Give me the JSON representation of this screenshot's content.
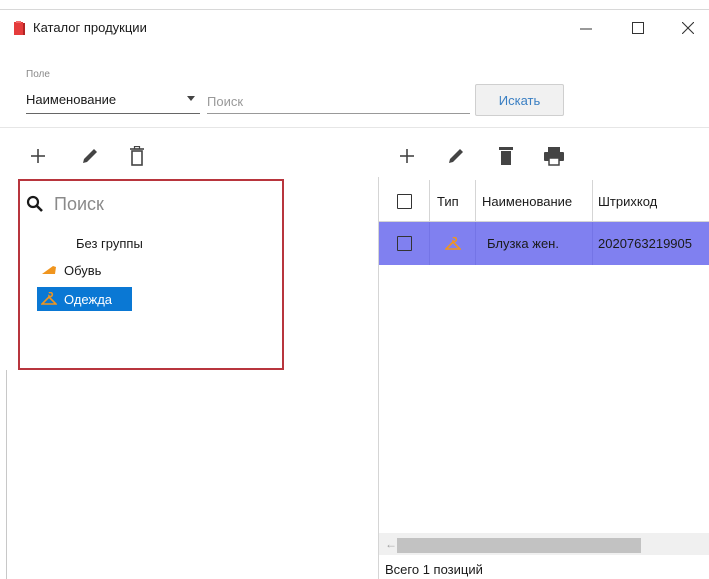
{
  "window": {
    "title": "Каталог продукции",
    "controls": {
      "minimize": "minimize",
      "maximize": "maximize",
      "close": "close"
    }
  },
  "search_form": {
    "field_label": "Поле",
    "field_value": "Наименование",
    "search_placeholder": "Поиск",
    "search_button": "Искать"
  },
  "left_toolbar": {
    "icons": [
      "plus-icon",
      "pencil-icon",
      "trash-outline-icon"
    ]
  },
  "right_toolbar": {
    "icons": [
      "plus-icon",
      "pencil-icon",
      "trash-filled-icon",
      "printer-icon"
    ]
  },
  "groups_tree": {
    "search_placeholder": "Поиск",
    "items": [
      {
        "label": "Без группы",
        "icon": "",
        "selected": false
      },
      {
        "label": "Обувь",
        "icon": "shoe-icon",
        "selected": false
      },
      {
        "label": "Одежда",
        "icon": "hanger-icon",
        "selected": true
      }
    ]
  },
  "products_table": {
    "columns": [
      "",
      "Тип",
      "Наименование",
      "Штрихкод"
    ],
    "rows": [
      {
        "checked": false,
        "type_icon": "hanger-icon",
        "name": "Блузка жен.",
        "barcode": "2020763219905"
      }
    ]
  },
  "status": {
    "total": "Всего 1 позиций"
  },
  "colors": {
    "accent": "#0a78d4",
    "selected_row": "#8080f0",
    "highlight_border": "#b8353d",
    "icon_orange": "#f0951e",
    "button_text": "#3a7fc3"
  }
}
